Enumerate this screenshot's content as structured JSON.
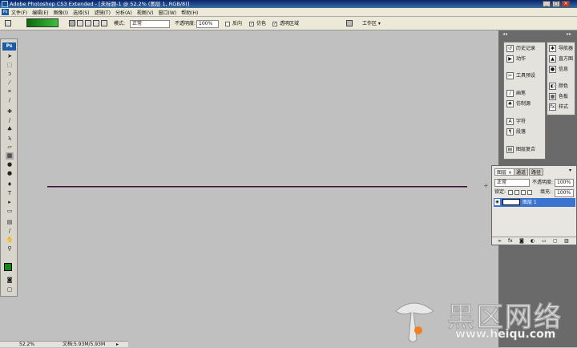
{
  "window": {
    "title": "Adobe Photoshop CS3 Extended - [未标题-1 @ 52.2% (图层 1, RGB/8)]",
    "min": "_",
    "max": "□",
    "close": "×"
  },
  "menu": [
    "文件(F)",
    "编辑(E)",
    "图像(I)",
    "选择(S)",
    "滤镜(T)",
    "分析(A)",
    "视图(V)",
    "窗口(W)",
    "帮助(H)"
  ],
  "options": {
    "mode_label": "模式:",
    "mode_value": "正常",
    "opacity_label": "不透明度:",
    "opacity_value": "100%",
    "reverse_label": "反向",
    "dither_label": "仿色",
    "transparency_label": "透明区域",
    "workspace_label": "工作区 ▾"
  },
  "toolbox": {
    "logo": "Ps"
  },
  "dock": {
    "left_items": [
      "历史记录",
      "动作",
      "工具预设",
      "画笔",
      "仿制源",
      "字符",
      "段落",
      "图层复合"
    ],
    "right_items": [
      "导航器",
      "直方图",
      "信息",
      "颜色",
      "色板",
      "样式"
    ]
  },
  "layers": {
    "tabs": [
      "图层 ×",
      "通道",
      "路径"
    ],
    "blend_mode": "正常",
    "opacity_label": "不透明度:",
    "opacity_value": "100%",
    "lock_label": "锁定:",
    "fill_label": "填充:",
    "fill_value": "100%",
    "layer_name": "图层 1"
  },
  "status": {
    "zoom": "52.2%",
    "doc": "文档:5.93M/5.93M"
  },
  "watermark": {
    "text": "黑区网络",
    "url": "www.heiqu.com"
  },
  "colors": {
    "foreground": "#108a10",
    "background": "#ffffff"
  }
}
